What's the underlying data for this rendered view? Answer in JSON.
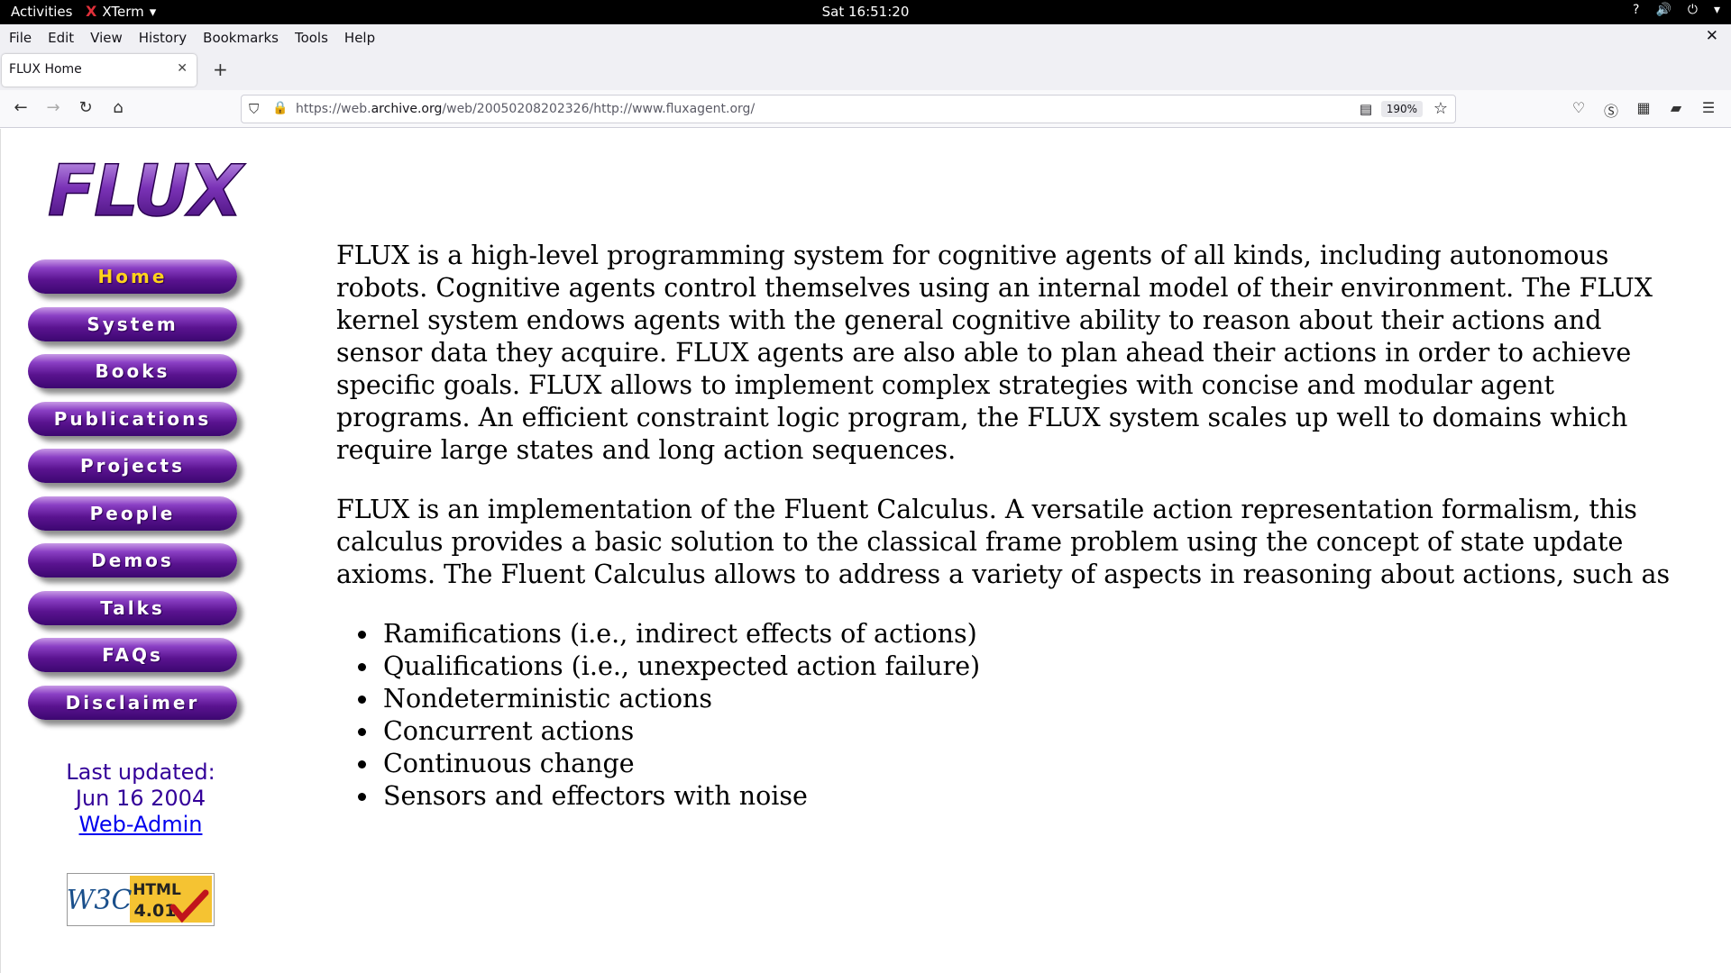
{
  "topbar": {
    "activities": "Activities",
    "app_name": "XTerm",
    "clock": "Sat 16:51:20"
  },
  "menubar": {
    "items": [
      "File",
      "Edit",
      "View",
      "History",
      "Bookmarks",
      "Tools",
      "Help"
    ],
    "close": "✕"
  },
  "tabs": [
    {
      "title": "FLUX Home",
      "close": "✕"
    }
  ],
  "newtab": "+",
  "urlbar": {
    "url_prefix": "https://web.",
    "url_host": "archive.org",
    "url_path": "/web/20050208202326/http://www.fluxagent.org/",
    "zoom": "190%"
  },
  "site": {
    "logo_text": "FLUX",
    "nav": [
      "Home",
      "System",
      "Books",
      "Publications",
      "Projects",
      "People",
      "Demos",
      "Talks",
      "FAQs",
      "Disclaimer"
    ],
    "active_nav": "Home",
    "last_updated_label": "Last updated:",
    "last_updated_date": "Jun 16 2004",
    "admin_link": "Web-Admin",
    "w3c_badge": {
      "left": "W3C",
      "right_top": "HTML",
      "right_bottom": "4.01"
    }
  },
  "content": {
    "paragraph1": "FLUX is a high-level programming system for cognitive agents of all kinds, including autonomous robots. Cognitive agents control themselves using an internal model of their environment. The FLUX kernel system endows agents with the general cognitive ability to reason about their actions and sensor data they acquire. FLUX agents are also able to plan ahead their actions in order to achieve specific goals. FLUX allows to implement complex strategies with concise and modular agent programs. An efficient constraint logic program, the FLUX system scales up well to domains which require large states and long action sequences.",
    "paragraph2": "FLUX is an implementation of the Fluent Calculus. A versatile action representation formalism, this calculus provides a basic solution to the classical frame problem using the concept of state update axioms. The Fluent Calculus allows to address a variety of aspects in reasoning about actions, such as",
    "list": [
      "Ramifications (i.e., indirect effects of actions)",
      "Qualifications (i.e., unexpected action failure)",
      "Nondeterministic actions",
      "Concurrent actions",
      "Continuous change",
      "Sensors and effectors with noise"
    ]
  },
  "colors": {
    "nav_purple": "#5a1390",
    "nav_active_text": "#ffd21c",
    "updated_text": "#330099",
    "link": "#0000ee"
  }
}
